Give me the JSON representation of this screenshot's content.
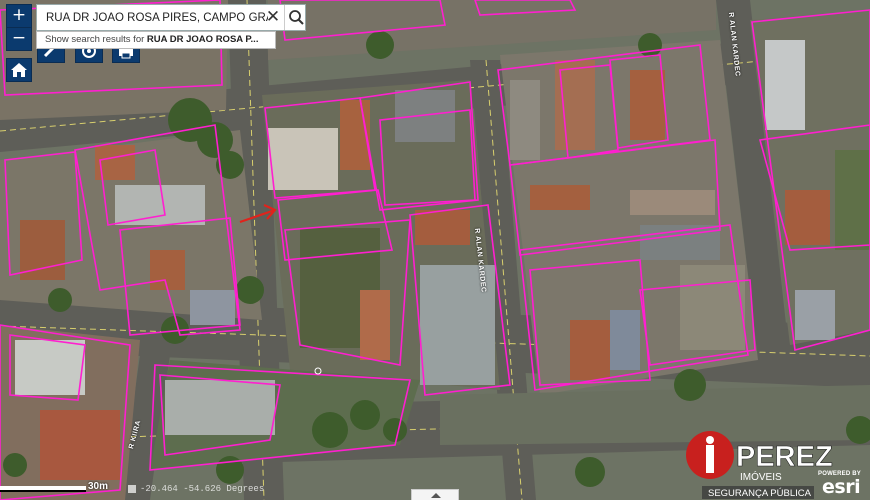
{
  "search": {
    "value": "RUA DR JOAO ROSA PIRES, CAMPO GRANI",
    "clear_icon": "close-icon",
    "search_icon": "search-icon"
  },
  "suggestion": {
    "prefix": "Show search results for ",
    "query": "RUA DR JOAO ROSA P..."
  },
  "controls": {
    "zoom_in": "+",
    "zoom_out": "−",
    "home_icon": "home-icon",
    "tools": [
      "pencil-icon",
      "layers-icon",
      "print-icon"
    ]
  },
  "streets": {
    "kaiuwk": "R ALAN KARDEC",
    "top_right": "R ALAN KARDEC",
    "diagonal": "R KIIRA"
  },
  "scale": {
    "label": "30m"
  },
  "coordinates": {
    "text": "-20.464  -54.626 Degrees"
  },
  "brand": {
    "name": "PEREZ",
    "subtitle": "IMÓVEIS",
    "tagline": "SEGURANÇA PÚBLICA",
    "colors": {
      "red": "#c8201e",
      "parcel": "#ff1fd0",
      "ui_blue": "#0b3a6e"
    }
  },
  "esri": {
    "powered_by": "POWERED BY",
    "name": "esri"
  }
}
